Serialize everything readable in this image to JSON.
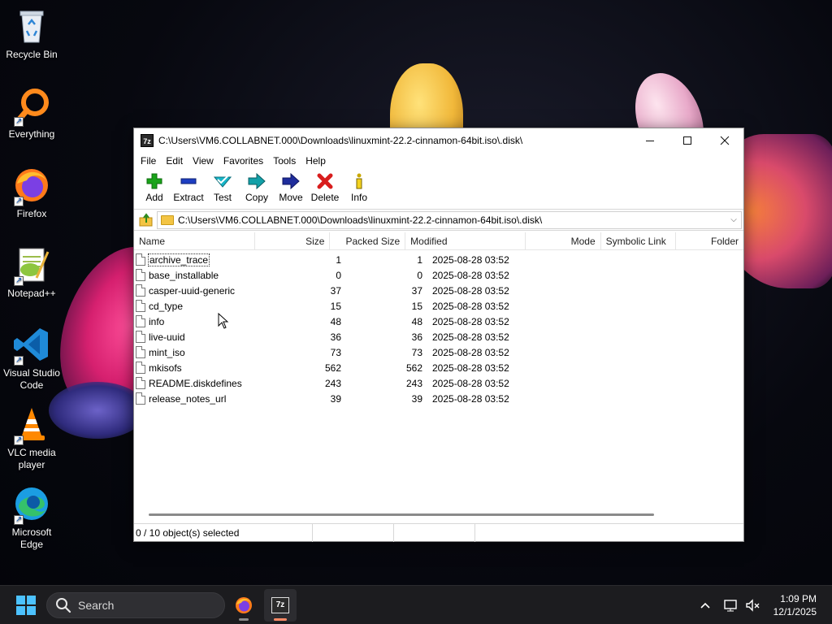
{
  "desktop": {
    "icons": [
      {
        "label": "Recycle Bin",
        "icon": "recycle-bin-icon"
      },
      {
        "label": "Everything",
        "icon": "everything-search-icon"
      },
      {
        "label": "Firefox",
        "icon": "firefox-icon"
      },
      {
        "label": "Notepad++",
        "icon": "notepad-plus-plus-icon"
      },
      {
        "label": "Visual Studio Code",
        "icon": "vscode-icon"
      },
      {
        "label": "VLC media player",
        "icon": "vlc-icon"
      },
      {
        "label": "Microsoft Edge",
        "icon": "edge-icon"
      }
    ]
  },
  "window": {
    "title": "C:\\Users\\VM6.COLLABNET.000\\Downloads\\linuxmint-22.2-cinnamon-64bit.iso\\.disk\\",
    "app_icon_text": "7z",
    "menu": [
      "File",
      "Edit",
      "View",
      "Favorites",
      "Tools",
      "Help"
    ],
    "toolbar": [
      {
        "label": "Add",
        "icon": "add-icon",
        "color": "#19a319"
      },
      {
        "label": "Extract",
        "icon": "extract-icon",
        "color": "#1d3ec2"
      },
      {
        "label": "Test",
        "icon": "test-icon",
        "color": "#18b6c9"
      },
      {
        "label": "Copy",
        "icon": "copy-icon",
        "color": "#12a0a8"
      },
      {
        "label": "Move",
        "icon": "move-icon",
        "color": "#1f2d9c"
      },
      {
        "label": "Delete",
        "icon": "delete-icon",
        "color": "#d81d1d"
      },
      {
        "label": "Info",
        "icon": "info-icon",
        "color": "#c9a800"
      }
    ],
    "address": "C:\\Users\\VM6.COLLABNET.000\\Downloads\\linuxmint-22.2-cinnamon-64bit.iso\\.disk\\",
    "columns": {
      "name": "Name",
      "size": "Size",
      "packed": "Packed Size",
      "modified": "Modified",
      "mode": "Mode",
      "symlink": "Symbolic Link",
      "folder": "Folder"
    },
    "files": [
      {
        "name": "archive_trace",
        "size": "1",
        "packed": "1",
        "modified": "2025-08-28 03:52"
      },
      {
        "name": "base_installable",
        "size": "0",
        "packed": "0",
        "modified": "2025-08-28 03:52"
      },
      {
        "name": "casper-uuid-generic",
        "size": "37",
        "packed": "37",
        "modified": "2025-08-28 03:52"
      },
      {
        "name": "cd_type",
        "size": "15",
        "packed": "15",
        "modified": "2025-08-28 03:52"
      },
      {
        "name": "info",
        "size": "48",
        "packed": "48",
        "modified": "2025-08-28 03:52"
      },
      {
        "name": "live-uuid",
        "size": "36",
        "packed": "36",
        "modified": "2025-08-28 03:52"
      },
      {
        "name": "mint_iso",
        "size": "73",
        "packed": "73",
        "modified": "2025-08-28 03:52"
      },
      {
        "name": "mkisofs",
        "size": "562",
        "packed": "562",
        "modified": "2025-08-28 03:52"
      },
      {
        "name": "README.diskdefines",
        "size": "243",
        "packed": "243",
        "modified": "2025-08-28 03:52"
      },
      {
        "name": "release_notes_url",
        "size": "39",
        "packed": "39",
        "modified": "2025-08-28 03:52"
      }
    ],
    "status": "0 / 10 object(s) selected"
  },
  "taskbar": {
    "search_placeholder": "Search",
    "apps": [
      {
        "name": "firefox-taskbar-icon"
      },
      {
        "name": "7zip-taskbar-icon",
        "label": "7z",
        "active": true
      }
    ],
    "time": "1:09 PM",
    "date": "12/1/2025"
  }
}
